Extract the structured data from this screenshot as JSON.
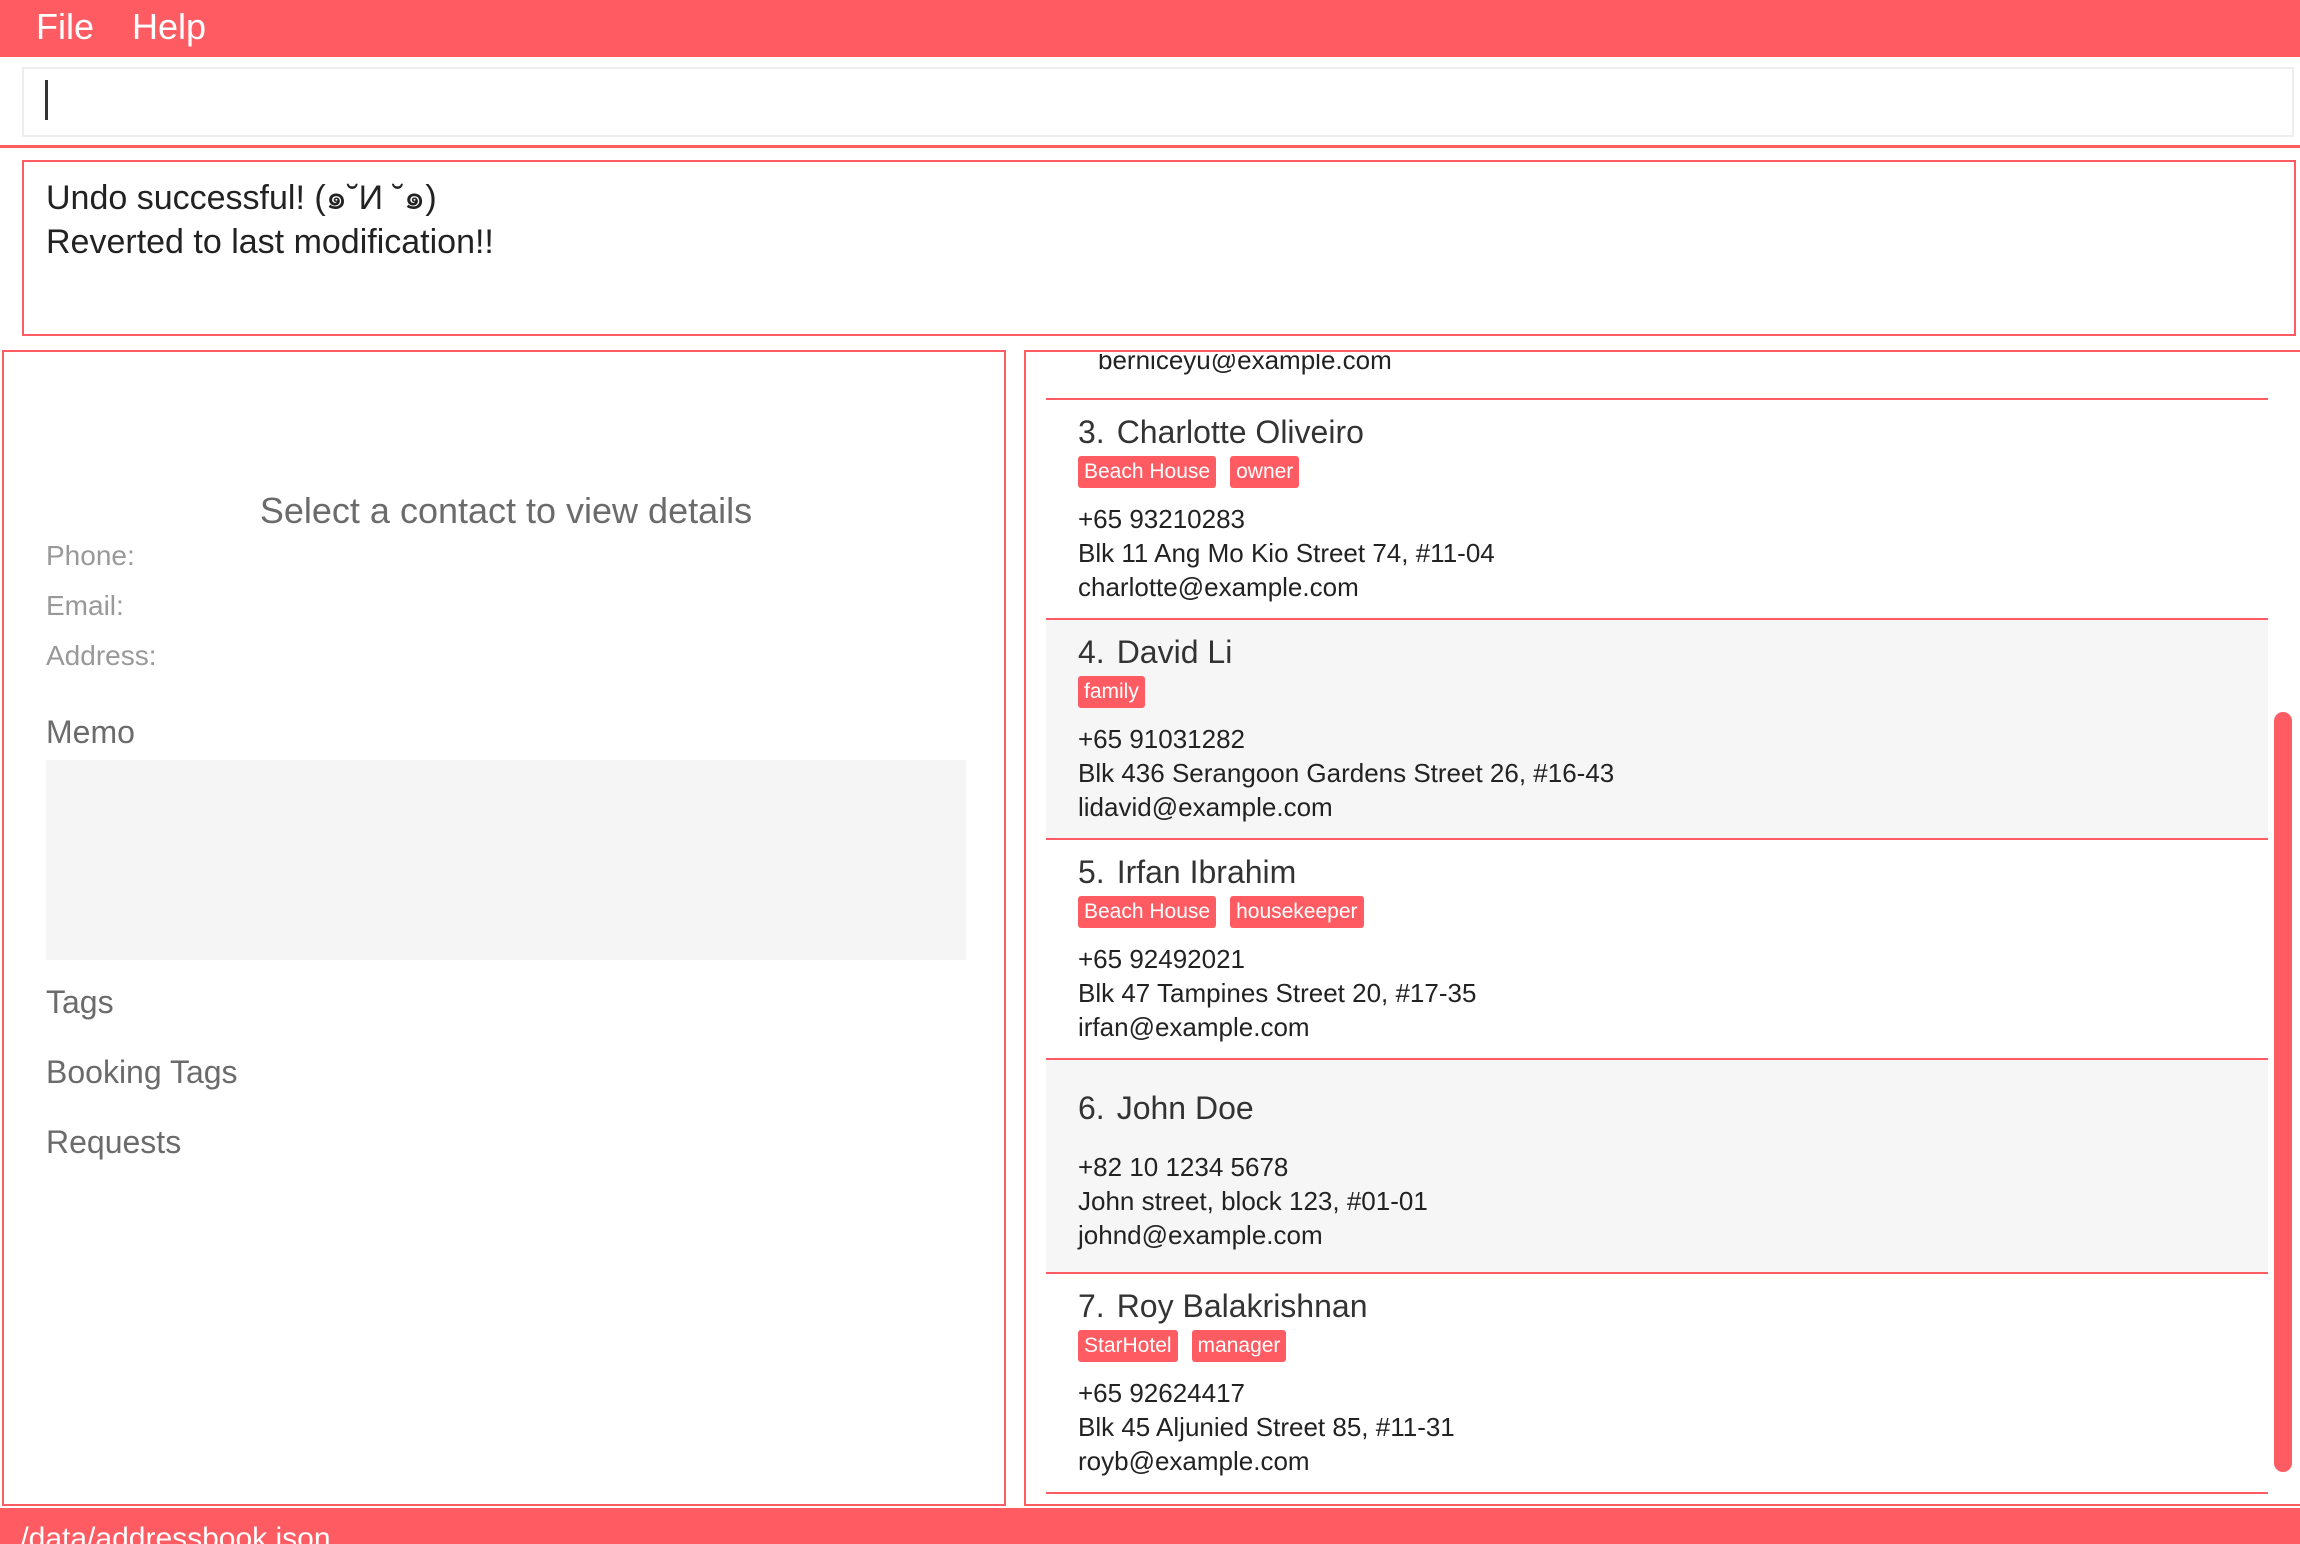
{
  "menubar": {
    "items": [
      "File",
      "Help"
    ]
  },
  "command": {
    "value": "",
    "placeholder": ""
  },
  "result": {
    "lines": [
      "Undo successful! (๑˘И ˘๑)",
      "Reverted to last modification!!"
    ]
  },
  "details": {
    "placeholder": "Select a contact to view details",
    "phone_label": "Phone:",
    "email_label": "Email:",
    "address_label": "Address:",
    "memo_label": "Memo",
    "tags_label": "Tags",
    "booking_tags_label": "Booking Tags",
    "requests_label": "Requests"
  },
  "list": {
    "partial_email": "berniceyu@example.com",
    "contacts": [
      {
        "index": "3.",
        "name": "Charlotte Oliveiro",
        "tags": [
          "Beach House",
          "owner"
        ],
        "phone": "+65 93210283",
        "address": "Blk 11 Ang Mo Kio Street 74, #11-04",
        "email": "charlotte@example.com"
      },
      {
        "index": "4.",
        "name": "David Li",
        "tags": [
          "family"
        ],
        "phone": "+65 91031282",
        "address": "Blk 436 Serangoon Gardens Street 26, #16-43",
        "email": "lidavid@example.com"
      },
      {
        "index": "5.",
        "name": "Irfan Ibrahim",
        "tags": [
          "Beach House",
          "housekeeper"
        ],
        "phone": "+65 92492021",
        "address": "Blk 47 Tampines Street 20, #17-35",
        "email": "irfan@example.com"
      },
      {
        "index": "6.",
        "name": "John Doe",
        "tags": [],
        "phone": "+82 10 1234 5678",
        "address": "John street, block 123, #01-01",
        "email": "johnd@example.com"
      },
      {
        "index": "7.",
        "name": "Roy Balakrishnan",
        "tags": [
          "StarHotel",
          "manager"
        ],
        "phone": "+65 92624417",
        "address": "Blk 45 Aljunied Street 85, #11-31",
        "email": "royb@example.com"
      }
    ]
  },
  "status": {
    "path": "./data/addressbook.json"
  },
  "colors": {
    "accent": "#fe5c62",
    "alt_row": "#f6f6f6",
    "memo_bg": "#f5f5f5"
  }
}
